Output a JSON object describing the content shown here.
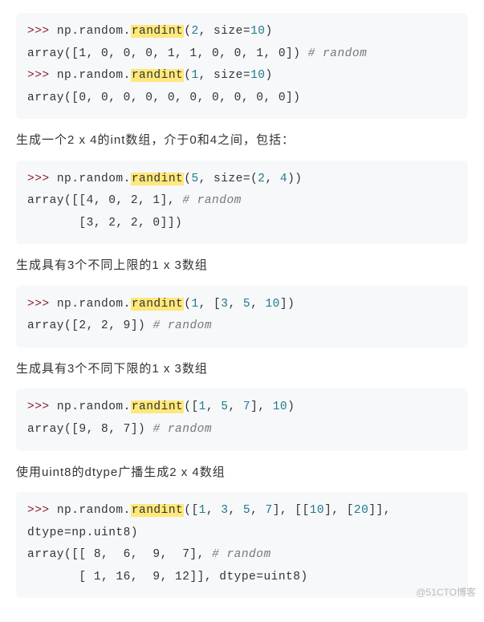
{
  "blocks": [
    {
      "type": "code",
      "lines": [
        {
          "segments": [
            {
              "t": ">>> ",
              "cls": "prompt"
            },
            {
              "t": "np.random.",
              "cls": "func"
            },
            {
              "t": "randint",
              "cls": "hl"
            },
            {
              "t": "(",
              "cls": "func"
            },
            {
              "t": "2",
              "cls": "num"
            },
            {
              "t": ", size=",
              "cls": "func"
            },
            {
              "t": "10",
              "cls": "num"
            },
            {
              "t": ")",
              "cls": "func"
            }
          ]
        },
        {
          "segments": [
            {
              "t": "array([1, 0, 0, 0, 1, 1, 0, 0, 1, 0]) ",
              "cls": "func"
            },
            {
              "t": "# random",
              "cls": "comment"
            }
          ]
        },
        {
          "segments": [
            {
              "t": ">>> ",
              "cls": "prompt"
            },
            {
              "t": "np.random.",
              "cls": "func"
            },
            {
              "t": "randint",
              "cls": "hl"
            },
            {
              "t": "(",
              "cls": "func"
            },
            {
              "t": "1",
              "cls": "num"
            },
            {
              "t": ", size=",
              "cls": "func"
            },
            {
              "t": "10",
              "cls": "num"
            },
            {
              "t": ")",
              "cls": "func"
            }
          ]
        },
        {
          "segments": [
            {
              "t": "array([0, 0, 0, 0, 0, 0, 0, 0, 0, 0])",
              "cls": "func"
            }
          ]
        }
      ]
    },
    {
      "type": "text",
      "text": "生成一个2 x 4的int数组，介于0和4之间，包括："
    },
    {
      "type": "code",
      "lines": [
        {
          "segments": [
            {
              "t": ">>> ",
              "cls": "prompt"
            },
            {
              "t": "np.random.",
              "cls": "func"
            },
            {
              "t": "randint",
              "cls": "hl"
            },
            {
              "t": "(",
              "cls": "func"
            },
            {
              "t": "5",
              "cls": "num"
            },
            {
              "t": ", size=(",
              "cls": "func"
            },
            {
              "t": "2",
              "cls": "num"
            },
            {
              "t": ", ",
              "cls": "func"
            },
            {
              "t": "4",
              "cls": "num"
            },
            {
              "t": "))",
              "cls": "func"
            }
          ]
        },
        {
          "segments": [
            {
              "t": "array([[4, 0, 2, 1], ",
              "cls": "func"
            },
            {
              "t": "# random",
              "cls": "comment"
            }
          ]
        },
        {
          "segments": [
            {
              "t": "       [3, 2, 2, 0]])",
              "cls": "func"
            }
          ]
        }
      ]
    },
    {
      "type": "text",
      "text": "生成具有3个不同上限的1 x 3数组"
    },
    {
      "type": "code",
      "lines": [
        {
          "segments": [
            {
              "t": ">>> ",
              "cls": "prompt"
            },
            {
              "t": "np.random.",
              "cls": "func"
            },
            {
              "t": "randint",
              "cls": "hl"
            },
            {
              "t": "(",
              "cls": "func"
            },
            {
              "t": "1",
              "cls": "num"
            },
            {
              "t": ", [",
              "cls": "func"
            },
            {
              "t": "3",
              "cls": "num"
            },
            {
              "t": ", ",
              "cls": "func"
            },
            {
              "t": "5",
              "cls": "num"
            },
            {
              "t": ", ",
              "cls": "func"
            },
            {
              "t": "10",
              "cls": "num"
            },
            {
              "t": "])",
              "cls": "func"
            }
          ]
        },
        {
          "segments": [
            {
              "t": "array([2, 2, 9]) ",
              "cls": "func"
            },
            {
              "t": "# random",
              "cls": "comment"
            }
          ]
        }
      ]
    },
    {
      "type": "text",
      "text": "生成具有3个不同下限的1 x 3数组"
    },
    {
      "type": "code",
      "lines": [
        {
          "segments": [
            {
              "t": ">>> ",
              "cls": "prompt"
            },
            {
              "t": "np.random.",
              "cls": "func"
            },
            {
              "t": "randint",
              "cls": "hl"
            },
            {
              "t": "([",
              "cls": "func"
            },
            {
              "t": "1",
              "cls": "num"
            },
            {
              "t": ", ",
              "cls": "func"
            },
            {
              "t": "5",
              "cls": "num"
            },
            {
              "t": ", ",
              "cls": "func"
            },
            {
              "t": "7",
              "cls": "num"
            },
            {
              "t": "], ",
              "cls": "func"
            },
            {
              "t": "10",
              "cls": "num"
            },
            {
              "t": ")",
              "cls": "func"
            }
          ]
        },
        {
          "segments": [
            {
              "t": "array([9, 8, 7]) ",
              "cls": "func"
            },
            {
              "t": "# random",
              "cls": "comment"
            }
          ]
        }
      ]
    },
    {
      "type": "text",
      "text": "使用uint8的dtype广播生成2 x 4数组"
    },
    {
      "type": "code",
      "lines": [
        {
          "segments": [
            {
              "t": ">>> ",
              "cls": "prompt"
            },
            {
              "t": "np.random.",
              "cls": "func"
            },
            {
              "t": "randint",
              "cls": "hl"
            },
            {
              "t": "([",
              "cls": "func"
            },
            {
              "t": "1",
              "cls": "num"
            },
            {
              "t": ", ",
              "cls": "func"
            },
            {
              "t": "3",
              "cls": "num"
            },
            {
              "t": ", ",
              "cls": "func"
            },
            {
              "t": "5",
              "cls": "num"
            },
            {
              "t": ", ",
              "cls": "func"
            },
            {
              "t": "7",
              "cls": "num"
            },
            {
              "t": "], [[",
              "cls": "func"
            },
            {
              "t": "10",
              "cls": "num"
            },
            {
              "t": "], [",
              "cls": "func"
            },
            {
              "t": "20",
              "cls": "num"
            },
            {
              "t": "]], dtype=np.uint8)",
              "cls": "func"
            }
          ]
        },
        {
          "segments": [
            {
              "t": "array([[ 8,  6,  9,  7], ",
              "cls": "func"
            },
            {
              "t": "# random",
              "cls": "comment"
            }
          ]
        },
        {
          "segments": [
            {
              "t": "       [ 1, 16,  9, 12]], dtype=uint8)",
              "cls": "func"
            }
          ]
        }
      ]
    }
  ],
  "watermark": "@51CTO博客"
}
